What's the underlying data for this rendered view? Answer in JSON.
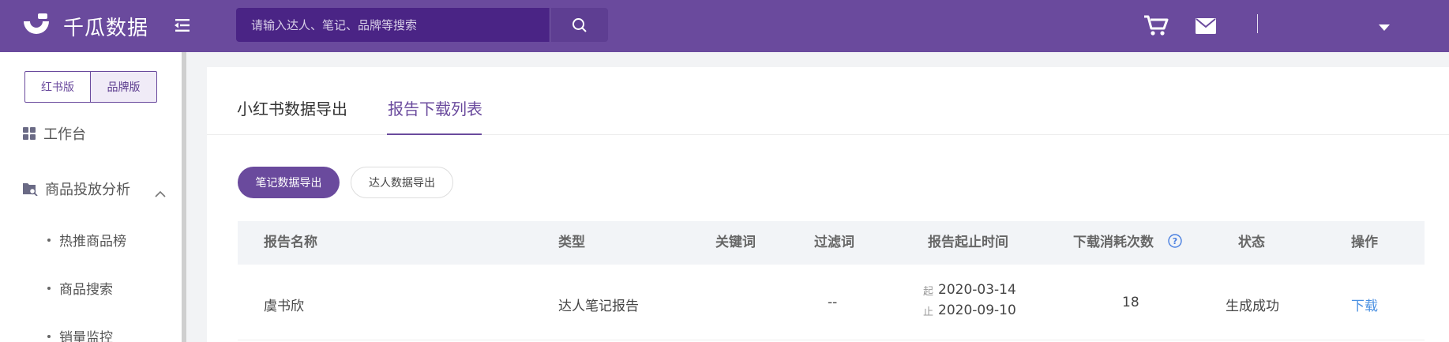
{
  "header": {
    "brand": "千瓜数据",
    "search_placeholder": "请输入达人、笔记、品牌等搜索",
    "icons": [
      "menu-fold-icon",
      "search-icon",
      "cart-icon",
      "mail-icon",
      "caret-down-icon"
    ]
  },
  "sidebar": {
    "versions": [
      "红书版",
      "品牌版"
    ],
    "active_version": "品牌版",
    "items": [
      {
        "label": "工作台",
        "icon": "grid-icon"
      },
      {
        "label": "商品投放分析",
        "icon": "folder-search-icon",
        "expanded": true
      }
    ],
    "sub_items": [
      "热推商品榜",
      "商品搜索",
      "销量监控"
    ]
  },
  "main": {
    "tabs": [
      "小红书数据导出",
      "报告下载列表"
    ],
    "active_tab": "报告下载列表",
    "filters": [
      "笔记数据导出",
      "达人数据导出"
    ],
    "active_filter": "笔记数据导出",
    "table": {
      "columns": [
        "报告名称",
        "类型",
        "关键词",
        "过滤词",
        "报告起止时间",
        "下载消耗次数",
        "状态",
        "操作"
      ],
      "rows": [
        {
          "name": "虞书欣",
          "type": "达人笔记报告",
          "keyword": "",
          "filter": "--",
          "start_tag": "起",
          "start": "2020-03-14",
          "end_tag": "止",
          "end": "2020-09-10",
          "count": "18",
          "status": "生成成功",
          "action": "下载"
        }
      ]
    }
  },
  "colors": {
    "brand": "#6a4a9d",
    "search_bg": "#4a2485",
    "link": "#4a90e2"
  }
}
